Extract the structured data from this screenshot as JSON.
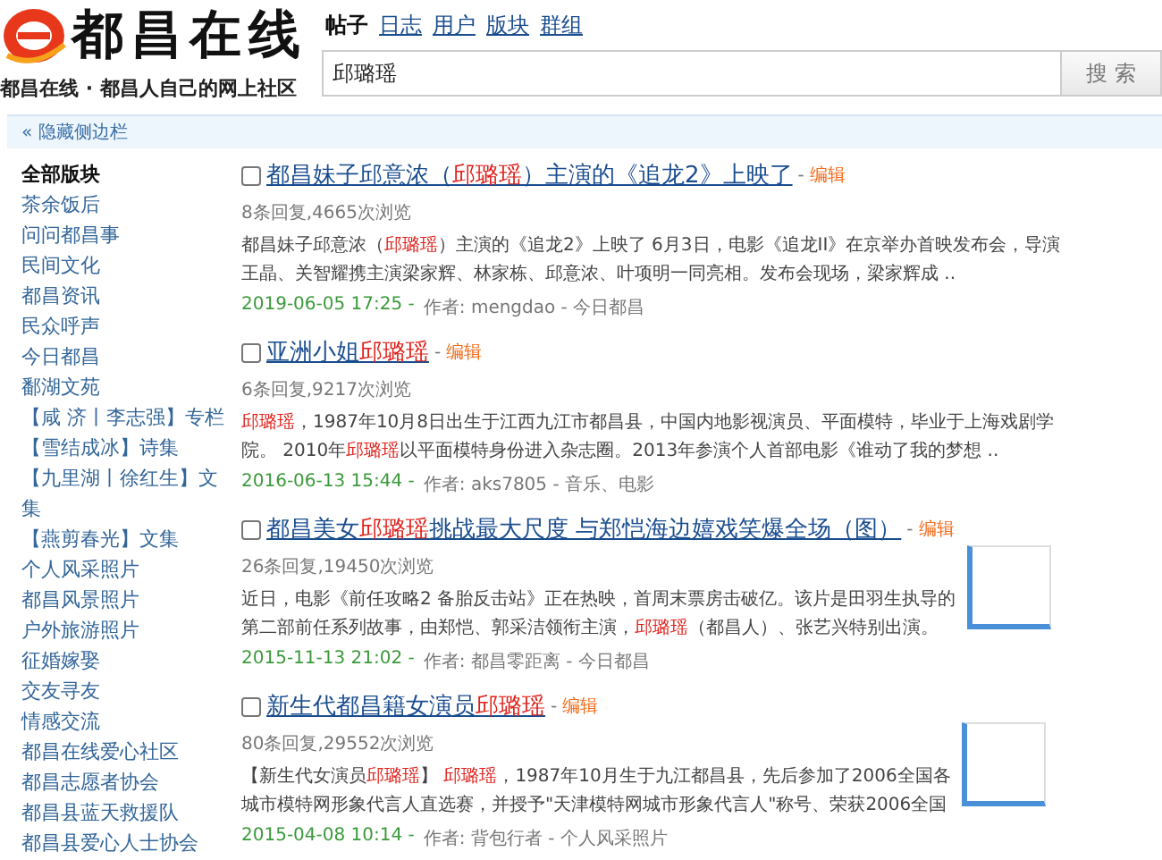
{
  "logo": {
    "name": "都昌在线",
    "tagline": "都昌在线 · 都昌人自己的网上社区"
  },
  "nav": [
    {
      "label": "帖子",
      "selected": true
    },
    {
      "label": "日志",
      "selected": false
    },
    {
      "label": "用户",
      "selected": false
    },
    {
      "label": "版块",
      "selected": false
    },
    {
      "label": "群组",
      "selected": false
    }
  ],
  "search": {
    "value": "邱璐瑶",
    "button": "搜 索"
  },
  "sidebar_toggle": "« 隐藏侧边栏",
  "sidebar": {
    "heading": "全部版块",
    "items": [
      "茶余饭后",
      "问问都昌事",
      "民间文化",
      "都昌资讯",
      "民众呼声",
      "今日都昌",
      "鄱湖文苑",
      "【咸 济丨李志强】专栏",
      "【雪结成冰】诗集",
      "【九里湖丨徐红生】文集",
      "【燕剪春光】文集",
      "个人风采照片",
      "都昌风景照片",
      "户外旅游照片",
      "征婚嫁娶",
      "交友寻友",
      "情感交流",
      "都昌在线爱心社区",
      "都昌志愿者协会",
      "都昌县蓝天救援队",
      "都昌县爱心人士协会"
    ]
  },
  "results": [
    {
      "checked": false,
      "title": [
        {
          "text": "都昌妹子邱意浓（",
          "highlight": false
        },
        {
          "text": "邱璐瑶",
          "highlight": true
        },
        {
          "text": "）主演的《追龙2》上映了",
          "highlight": false
        }
      ],
      "separator": "-",
      "edit": "编辑",
      "stats": "8条回复,4665次浏览",
      "snippet": [
        [
          {
            "text": "都昌妹子邱意浓（",
            "highlight": false
          },
          {
            "text": "邱璐瑶",
            "highlight": true
          },
          {
            "text": "）主演的《追龙2》上映了 6月3日，电影《追龙II》在京举办首映发布会，导演",
            "highlight": false
          }
        ],
        [
          {
            "text": "王晶、关智耀携主演梁家辉、林家栋、邱意浓、叶项明一同亮相。发布会现场，梁家辉成 ..",
            "highlight": false
          }
        ]
      ],
      "date": "2019-06-05 17:25 -",
      "byline": "作者: mengdao - 今日都昌",
      "thumbnail": false
    },
    {
      "checked": false,
      "title": [
        {
          "text": "亚洲小姐",
          "highlight": false
        },
        {
          "text": "邱璐瑶",
          "highlight": true
        }
      ],
      "separator": "-",
      "edit": "编辑",
      "stats": "6条回复,9217次浏览",
      "snippet": [
        [
          {
            "text": "邱璐瑶",
            "highlight": true
          },
          {
            "text": "，1987年10月8日出生于江西九江市都昌县，中国内地影视演员、平面模特，毕业于上海戏剧学",
            "highlight": false
          }
        ],
        [
          {
            "text": "院。 2010年",
            "highlight": false
          },
          {
            "text": "邱璐瑶",
            "highlight": true
          },
          {
            "text": "以平面模特身份进入杂志圈。2013年参演个人首部电影《谁动了我的梦想 ..",
            "highlight": false
          }
        ]
      ],
      "date": "2016-06-13 15:44 -",
      "byline": "作者: aks7805 - 音乐、电影",
      "thumbnail": false
    },
    {
      "checked": false,
      "title": [
        {
          "text": "都昌美女",
          "highlight": false
        },
        {
          "text": "邱璐瑶",
          "highlight": true
        },
        {
          "text": "挑战最大尺度 与郑恺海边嬉戏笑爆全场（图）",
          "highlight": false
        }
      ],
      "separator": "-",
      "edit": "编辑",
      "stats": "26条回复,19450次浏览",
      "snippet": [
        [
          {
            "text": "近日，电影《前任攻略2 备胎反击站》正在热映，首周末票房击破亿。该片是田羽生执导的",
            "highlight": false
          }
        ],
        [
          {
            "text": "第二部前任系列故事，由郑恺、郭采洁领衔主演，",
            "highlight": false
          },
          {
            "text": "邱璐瑶",
            "highlight": true
          },
          {
            "text": "（都昌人）、张艺兴特别出演。",
            "highlight": false
          }
        ]
      ],
      "date": "2015-11-13 21:02 -",
      "byline": "作者: 都昌零距离 - 今日都昌",
      "thumbnail": true
    },
    {
      "checked": false,
      "title": [
        {
          "text": "新生代都昌籍女演员",
          "highlight": false
        },
        {
          "text": "邱璐瑶",
          "highlight": true
        }
      ],
      "separator": "-",
      "edit": "编辑",
      "stats": "80条回复,29552次浏览",
      "snippet": [
        [
          {
            "text": "【新生代女演员",
            "highlight": false
          },
          {
            "text": "邱璐瑶",
            "highlight": true
          },
          {
            "text": "】 ",
            "highlight": false
          },
          {
            "text": "邱璐瑶",
            "highlight": true
          },
          {
            "text": "，1987年10月生于九江都昌县，先后参加了2006全国各",
            "highlight": false
          }
        ],
        [
          {
            "text": "城市模特网形象代言人直选赛，并授予\"天津模特网城市形象代言人\"称号、荣获2006全国",
            "highlight": false
          }
        ]
      ],
      "date": "2015-04-08 10:14 -",
      "byline": "作者: 背包行者 - 个人风采照片",
      "thumbnail": true
    }
  ]
}
